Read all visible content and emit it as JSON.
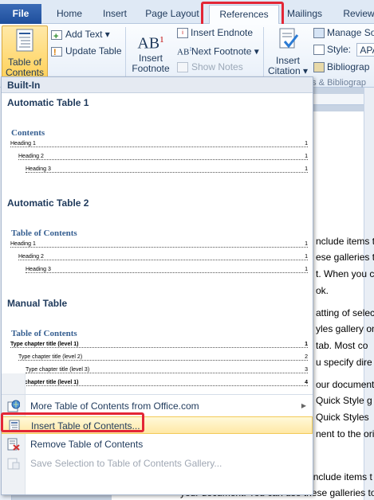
{
  "tabs": {
    "file": "File",
    "home": "Home",
    "insert": "Insert",
    "page_layout": "Page Layout",
    "references": "References",
    "mailings": "Mailings",
    "review": "Review"
  },
  "ribbon": {
    "toc_button": "Table of\nContents",
    "toc_line1": "Table of",
    "toc_line2": "Contents ▾",
    "add_text": "Add Text ▾",
    "update_table": "Update Table",
    "insert_footnote_line1": "Insert",
    "insert_footnote_line2": "Footnote",
    "insert_endnote": "Insert Endnote",
    "next_footnote": "Next Footnote ▾",
    "show_notes": "Show Notes",
    "insert_citation_line1": "Insert",
    "insert_citation_line2": "Citation ▾",
    "manage_sources": "Manage So",
    "style_label": "Style:",
    "style_value": "APA",
    "bibliography": "Bibliograp",
    "group_citations": "ns & Bibliograp"
  },
  "dropdown": {
    "header": "Built-In",
    "galleries": [
      {
        "title": "Automatic Table 1",
        "toc_title": "Contents",
        "lines": [
          {
            "label": "Heading 1",
            "page": "1",
            "level": 1
          },
          {
            "label": "Heading 2",
            "page": "1",
            "level": 2
          },
          {
            "label": "Heading 3",
            "page": "1",
            "level": 3
          }
        ]
      },
      {
        "title": "Automatic Table 2",
        "toc_title": "Table of Contents",
        "lines": [
          {
            "label": "Heading 1",
            "page": "1",
            "level": 1
          },
          {
            "label": "Heading 2",
            "page": "1",
            "level": 2
          },
          {
            "label": "Heading 3",
            "page": "1",
            "level": 3
          }
        ]
      },
      {
        "title": "Manual Table",
        "toc_title": "Table of Contents",
        "lines": [
          {
            "label": "Type chapter title (level 1)",
            "page": "1",
            "level": 1
          },
          {
            "label": "Type chapter title (level 2)",
            "page": "2",
            "level": 2
          },
          {
            "label": "Type chapter title (level 3)",
            "page": "3",
            "level": 3
          },
          {
            "label": "Type chapter title (level 1)",
            "page": "4",
            "level": 1
          }
        ]
      }
    ],
    "menu": {
      "more": "More Table of Contents from Office.com",
      "insert": "Insert Table of Contents...",
      "remove": "Remove Table of Contents",
      "save": "Save Selection to Table of Contents Gallery..."
    }
  },
  "document": {
    "lines": [
      "nclude items t",
      "ese galleries to",
      "t. When you c",
      "ok.",
      "atting of selec",
      "yles gallery on",
      "tab. Most co",
      "u specify dire",
      "our document",
      "Quick Style g",
      "Quick Styles",
      "nent to the orig"
    ],
    "bottom_lines": [
      "On the Insert tab, the galleries include items t",
      "your document. You can use these galleries to"
    ]
  },
  "colors": {
    "highlight_border": "#e32636",
    "file_tab": "#2b579a",
    "toc_heading": "#365f91",
    "menu_hover": "#ffe8a6"
  }
}
